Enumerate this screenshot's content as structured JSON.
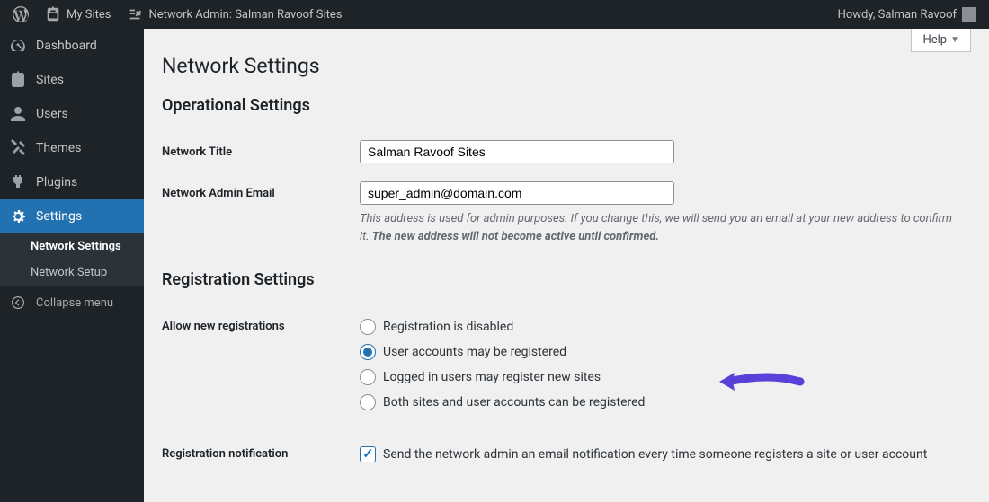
{
  "adminbar": {
    "my_sites": "My Sites",
    "network_admin": "Network Admin: Salman Ravoof Sites",
    "howdy": "Howdy, Salman Ravoof"
  },
  "sidebar": {
    "items": [
      {
        "label": "Dashboard"
      },
      {
        "label": "Sites"
      },
      {
        "label": "Users"
      },
      {
        "label": "Themes"
      },
      {
        "label": "Plugins"
      },
      {
        "label": "Settings"
      }
    ],
    "submenu": [
      {
        "label": "Network Settings"
      },
      {
        "label": "Network Setup"
      }
    ],
    "collapse": "Collapse menu"
  },
  "help": "Help",
  "page": {
    "title": "Network Settings",
    "section1": "Operational Settings",
    "network_title_label": "Network Title",
    "network_title_value": "Salman Ravoof Sites",
    "admin_email_label": "Network Admin Email",
    "admin_email_value": "super_admin@domain.com",
    "admin_email_desc_a": "This address is used for admin purposes. If you change this, we will send you an email at your new address to confirm it. ",
    "admin_email_desc_b": "The new address will not become active until confirmed.",
    "section2": "Registration Settings",
    "allow_reg_label": "Allow new registrations",
    "reg_options": [
      "Registration is disabled",
      "User accounts may be registered",
      "Logged in users may register new sites",
      "Both sites and user accounts can be registered"
    ],
    "reg_notif_label": "Registration notification",
    "reg_notif_text": "Send the network admin an email notification every time someone registers a site or user account"
  }
}
